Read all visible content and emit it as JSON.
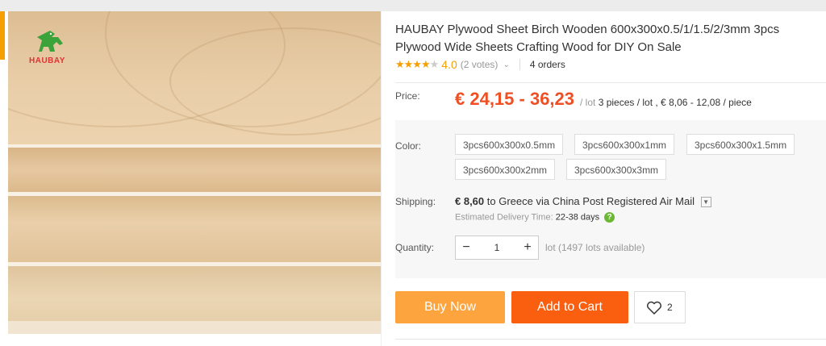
{
  "product": {
    "brand_logo_text": "HAUBAY",
    "title": "HAUBAY Plywood Sheet Birch Wooden 600x300x0.5/1/1.5/2/3mm 3pcs Plywood Wide Sheets Crafting Wood for DIY On Sale",
    "rating": {
      "stars": 4.0,
      "value": "4.0",
      "votes": "(2 votes)",
      "orders": "4 orders"
    },
    "price": {
      "label": "Price:",
      "value": "€ 24,15 - 36,23",
      "unit_prefix": "/ lot",
      "unit_detail": "3 pieces / lot , € 8,06 - 12,08 / piece"
    },
    "color": {
      "label": "Color:",
      "options": [
        "3pcs600x300x0.5mm",
        "3pcs600x300x1mm",
        "3pcs600x300x1.5mm",
        "3pcs600x300x2mm",
        "3pcs600x300x3mm"
      ]
    },
    "shipping": {
      "label": "Shipping:",
      "price": "€ 8,60",
      "destination": " to Greece via China Post Registered Air Mail",
      "delivery_label": "Estimated Delivery Time:",
      "delivery_days": "22-38 days"
    },
    "quantity": {
      "label": "Quantity:",
      "minus": "−",
      "value": "1",
      "plus": "+",
      "available": "lot (1497 lots available)"
    },
    "actions": {
      "buy_now": "Buy Now",
      "add_to_cart": "Add to Cart",
      "wishlist_count": "2"
    }
  },
  "colors": {
    "price": "#f04e23",
    "buy_now": "#fda43e",
    "add_to_cart": "#fa5e0f",
    "stars": "#f5a000",
    "help": "#6ab834"
  }
}
